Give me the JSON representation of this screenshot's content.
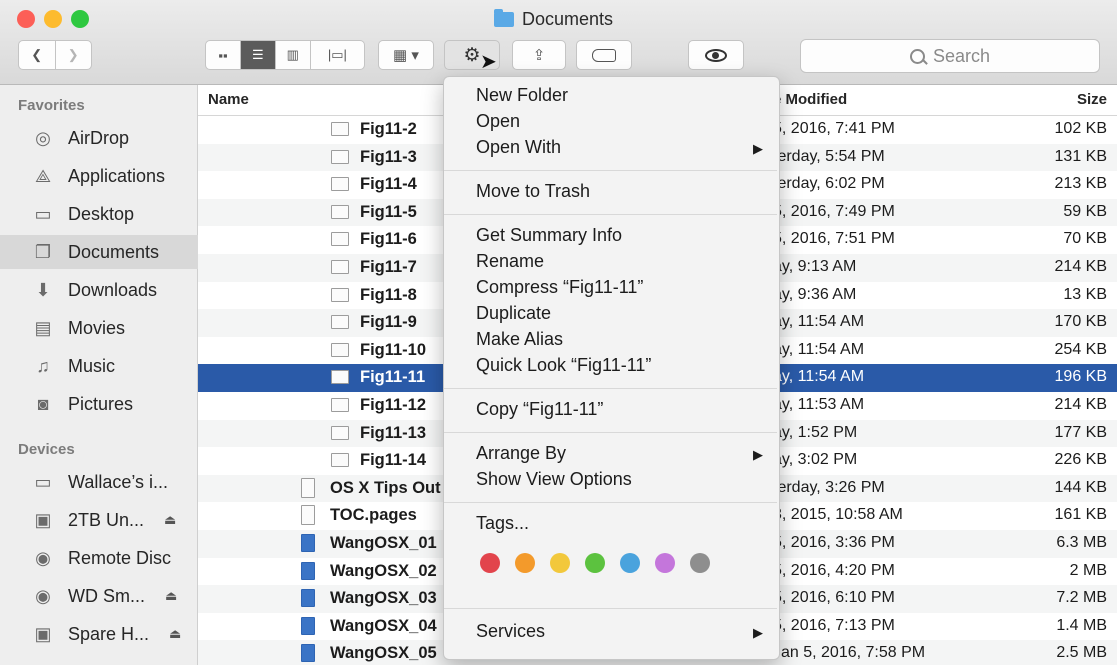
{
  "window": {
    "title": "Documents"
  },
  "toolbar": {
    "back_icon": "chevron-left-icon",
    "forward_icon": "chevron-right-icon",
    "view_icons": [
      "icon-view",
      "list-view",
      "column-view",
      "cover-flow-view"
    ],
    "arrange_label": "▾",
    "search_placeholder": "Search"
  },
  "sidebar": {
    "favorites_header": "Favorites",
    "devices_header": "Devices",
    "favorites": [
      {
        "label": "AirDrop",
        "icon": "airdrop-icon"
      },
      {
        "label": "Applications",
        "icon": "applications-icon"
      },
      {
        "label": "Desktop",
        "icon": "desktop-icon"
      },
      {
        "label": "Documents",
        "icon": "documents-icon",
        "selected": true
      },
      {
        "label": "Downloads",
        "icon": "downloads-icon"
      },
      {
        "label": "Movies",
        "icon": "movies-icon"
      },
      {
        "label": "Music",
        "icon": "music-icon"
      },
      {
        "label": "Pictures",
        "icon": "pictures-icon"
      }
    ],
    "devices": [
      {
        "label": "Wallace’s i...",
        "icon": "computer-icon",
        "eject": false
      },
      {
        "label": "2TB Un...",
        "icon": "drive-icon",
        "eject": true
      },
      {
        "label": "Remote Disc",
        "icon": "disc-icon",
        "eject": false
      },
      {
        "label": "WD Sm...",
        "icon": "disc-icon",
        "eject": true
      },
      {
        "label": "Spare H...",
        "icon": "drive-icon",
        "eject": true
      }
    ],
    "eject_glyph": "⏏"
  },
  "columns": {
    "name": "Name",
    "modified": "e Modified",
    "size": "Size"
  },
  "files": [
    {
      "name": "Fig11-2",
      "modified": "5, 2016, 7:41 PM",
      "size": "102 KB"
    },
    {
      "name": "Fig11-3",
      "modified": "terday, 5:54 PM",
      "size": "131 KB"
    },
    {
      "name": "Fig11-4",
      "modified": "terday, 6:02 PM",
      "size": "213 KB"
    },
    {
      "name": "Fig11-5",
      "modified": "5, 2016, 7:49 PM",
      "size": "59 KB"
    },
    {
      "name": "Fig11-6",
      "modified": "5, 2016, 7:51 PM",
      "size": "70 KB"
    },
    {
      "name": "Fig11-7",
      "modified": "ay, 9:13 AM",
      "size": "214 KB"
    },
    {
      "name": "Fig11-8",
      "modified": "ay, 9:36 AM",
      "size": "13 KB"
    },
    {
      "name": "Fig11-9",
      "modified": "ay, 11:54 AM",
      "size": "170 KB"
    },
    {
      "name": "Fig11-10",
      "modified": "ay, 11:54 AM",
      "size": "254 KB"
    },
    {
      "name": "Fig11-11",
      "modified": "ay, 11:54 AM",
      "size": "196 KB",
      "selected": true
    },
    {
      "name": "Fig11-12",
      "modified": "ay, 11:53 AM",
      "size": "214 KB"
    },
    {
      "name": "Fig11-13",
      "modified": "ay, 1:52 PM",
      "size": "177 KB"
    },
    {
      "name": "Fig11-14",
      "modified": "ay, 3:02 PM",
      "size": "226 KB"
    },
    {
      "name": "OS X Tips Out",
      "modified": "terday, 3:26 PM",
      "size": "144 KB",
      "kind": "doc"
    },
    {
      "name": "TOC.pages",
      "modified": "3, 2015, 10:58 AM",
      "size": "161 KB",
      "kind": "doc"
    },
    {
      "name": "WangOSX_01",
      "modified": "5, 2016, 3:36 PM",
      "size": "6.3 MB",
      "kind": "word"
    },
    {
      "name": "WangOSX_02",
      "modified": "5, 2016, 4:20 PM",
      "size": "2 MB",
      "kind": "word"
    },
    {
      "name": "WangOSX_03",
      "modified": "5, 2016, 6:10 PM",
      "size": "7.2 MB",
      "kind": "word"
    },
    {
      "name": "WangOSX_04",
      "modified": "5, 2016, 7:13 PM",
      "size": "1.4 MB",
      "kind": "word"
    },
    {
      "name": "WangOSX_05",
      "modified": "Jan 5, 2016, 7:58 PM",
      "size": "2.5 MB",
      "kind": "word"
    }
  ],
  "menu": {
    "groups": [
      [
        {
          "label": "New Folder"
        },
        {
          "label": "Open"
        },
        {
          "label": "Open With",
          "submenu": true
        }
      ],
      [
        {
          "label": "Move to Trash"
        }
      ],
      [
        {
          "label": "Get Summary Info"
        },
        {
          "label": "Rename"
        },
        {
          "label": "Compress “Fig11-11”"
        },
        {
          "label": "Duplicate"
        },
        {
          "label": "Make Alias"
        },
        {
          "label": "Quick Look “Fig11-11”"
        }
      ],
      [
        {
          "label": "Copy “Fig11-11”"
        }
      ],
      [
        {
          "label": "Arrange By",
          "submenu": true
        },
        {
          "label": "Show View Options"
        }
      ],
      [
        {
          "label": "Tags..."
        }
      ],
      [
        {
          "label": "Services",
          "submenu": true
        }
      ]
    ],
    "submenu_glyph": "▶",
    "tag_colors": [
      {
        "name": "red",
        "hex": "#e2444c"
      },
      {
        "name": "orange",
        "hex": "#f39a2b"
      },
      {
        "name": "yellow",
        "hex": "#f2c83c"
      },
      {
        "name": "green",
        "hex": "#5cc23f"
      },
      {
        "name": "blue",
        "hex": "#4aa3dd"
      },
      {
        "name": "purple",
        "hex": "#c476db"
      },
      {
        "name": "gray",
        "hex": "#8e8e8e"
      }
    ]
  },
  "colors": {
    "selection": "#2a5aa8",
    "sidebar_bg": "#eeeeee"
  }
}
